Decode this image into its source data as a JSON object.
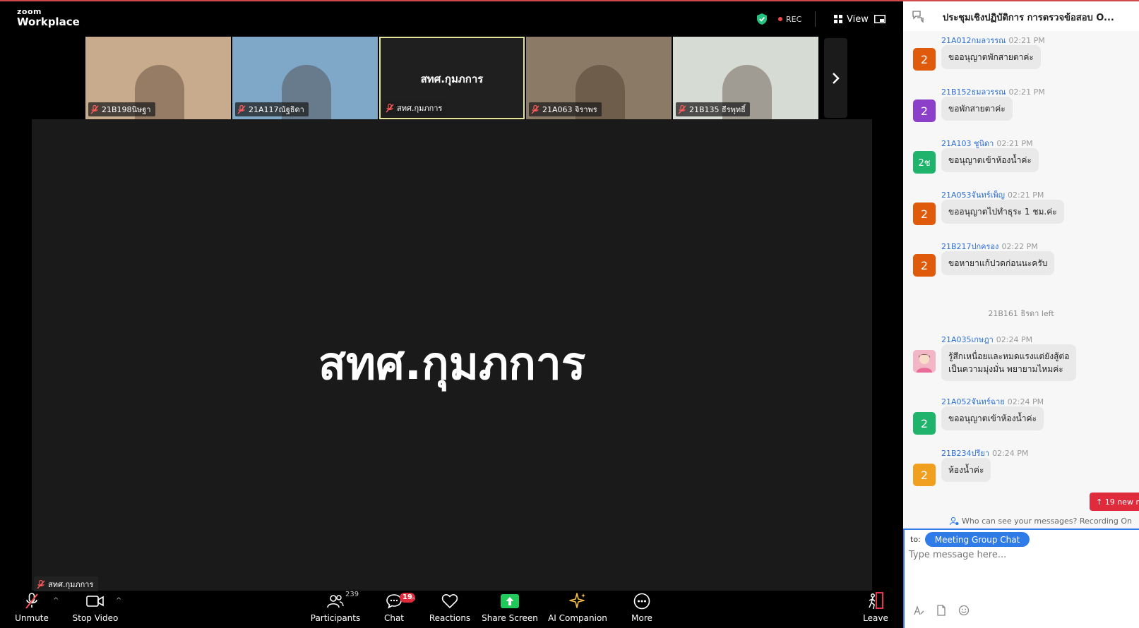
{
  "app": {
    "brand_small": "zoom",
    "brand_big": "Workplace"
  },
  "topbar": {
    "rec_label": "REC",
    "view_label": "View"
  },
  "gallery": [
    {
      "name": "21B198นิษฐา",
      "bg": "#c8aa8c"
    },
    {
      "name": "21A117ณัฐธิดา",
      "bg": "#7fa8c8"
    },
    {
      "name": "สทศ.กุมภการ",
      "bg": "#1f1f1f",
      "active": true
    },
    {
      "name": "21A063 จิราพร",
      "bg": "#8a7a66"
    },
    {
      "name": "21B135 ธีรพุทธิ์",
      "bg": "#d6dbd4"
    }
  ],
  "stage": {
    "center_name": "สทศ.กุมภการ",
    "label": "สทศ.กุมภการ"
  },
  "toolbar": {
    "unmute": "Unmute",
    "stop_video": "Stop Video",
    "participants": "Participants",
    "participants_count": "239",
    "chat": "Chat",
    "chat_badge": "19",
    "reactions": "Reactions",
    "share_screen": "Share Screen",
    "ai_companion": "AI Companion",
    "more": "More",
    "leave": "Leave"
  },
  "chat": {
    "title": "ประชุมเชิงปฏิบัติการ การตรวจข้อสอบ O...",
    "messages": [
      {
        "sender": "21A012กมลวรรณ",
        "time": "02:21 PM",
        "avatar": "2",
        "color": "#e05a0c",
        "text": "ขออนุญาตพักสายตาค่ะ"
      },
      {
        "sender": "21B152ธมลวรรณ",
        "time": "02:21 PM",
        "avatar": "2",
        "color": "#8c3fc9",
        "text": "ขอพักสายตาค่ะ"
      },
      {
        "sender": "21A103 ชูนิดา",
        "time": "02:21 PM",
        "avatar": "2ช",
        "color": "#1fb36b",
        "text": "ขอนุญาตเข้าห้องน้ำค่ะ"
      },
      {
        "sender": "21A053จันทร์เพ็ญ",
        "time": "02:21 PM",
        "avatar": "2",
        "color": "#e05a0c",
        "text": "ขออนุญาตไปทำธุระ 1 ชม.ค่ะ"
      },
      {
        "sender": "21B217ปกครอง",
        "time": "02:22 PM",
        "avatar": "2",
        "color": "#e05a0c",
        "text": "ขอหายาแก้ปวดก่อนนะครับ"
      }
    ],
    "system_line": "21B161 ธิรดา left",
    "message_6": {
      "sender": "21A035เกษฎา",
      "time": "02:24 PM",
      "line1": "รู้สึกเหนื่อยและหมดแรงแต่ยังสู้ต่อ",
      "line2": "เป็นความมุ่งมั่น พยายามไหมค่ะ"
    },
    "message_7": {
      "sender": "21A052จันทร์ฉาย",
      "time": "02:24 PM",
      "avatar": "2",
      "color": "#1fb36b",
      "text": "ขออนุญาตเข้าห้องน้ำค่ะ"
    },
    "message_8": {
      "sender": "21B234ปรียา",
      "time": "02:24 PM",
      "avatar": "2",
      "color": "#f0a01e",
      "text": "ห้องน้ำค่ะ"
    },
    "new_messages": "↑ 19 new m",
    "who_can_see": "Who can see your messages? Recording On",
    "to_label": "to:",
    "to_target": "Meeting Group Chat",
    "input_placeholder": "Type message here..."
  }
}
